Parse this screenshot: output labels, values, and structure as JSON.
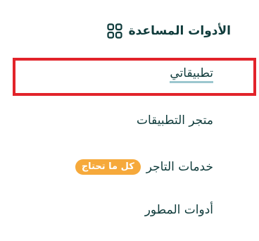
{
  "menu": {
    "title": "الأدوات المساعدة",
    "title_icon": "grid-icon",
    "items": [
      {
        "label": "تطبيقاتي",
        "selected": true
      },
      {
        "label": "متجر التطبيقات"
      },
      {
        "label": "خدمات التاجر",
        "badge": "كل ما تحتاج"
      },
      {
        "label": "أدوات المطور"
      }
    ]
  },
  "colors": {
    "text": "#0f3b3b",
    "underline": "#9cc7cf",
    "highlight_border": "#e2232a",
    "badge_bg": "#f6a93b",
    "badge_text": "#ffffff"
  }
}
